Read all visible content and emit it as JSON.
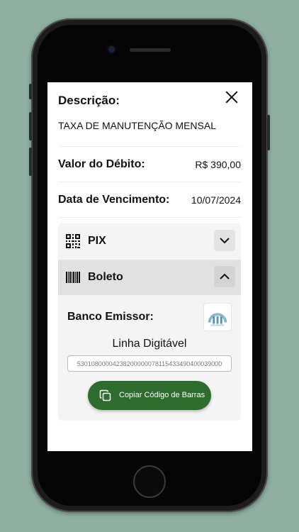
{
  "modal": {
    "description_label": "Descrição:",
    "description_value": "TAXA DE MANUTENÇÃO MENSAL",
    "amount_label": "Valor do Débito:",
    "amount_value": "R$ 390,00",
    "due_label": "Data de Vencimento:",
    "due_value": "10/07/2024"
  },
  "payment": {
    "pix": {
      "label": "PIX",
      "expanded": false,
      "icon": "qr-code-icon"
    },
    "boleto": {
      "label": "Boleto",
      "expanded": true,
      "icon": "barcode-icon",
      "bank_label": "Banco Emissor:",
      "linha_label": "Linha Digitável",
      "linha_value": "53010800004238200000078115433490400039000",
      "copy_button_label": "Copiar Código de Barras"
    }
  },
  "colors": {
    "background": "#8daea0",
    "accent": "#2e6b2f",
    "accordion_bg": "#f4f4f4",
    "accordion_active_bg": "#e1e1e1"
  }
}
